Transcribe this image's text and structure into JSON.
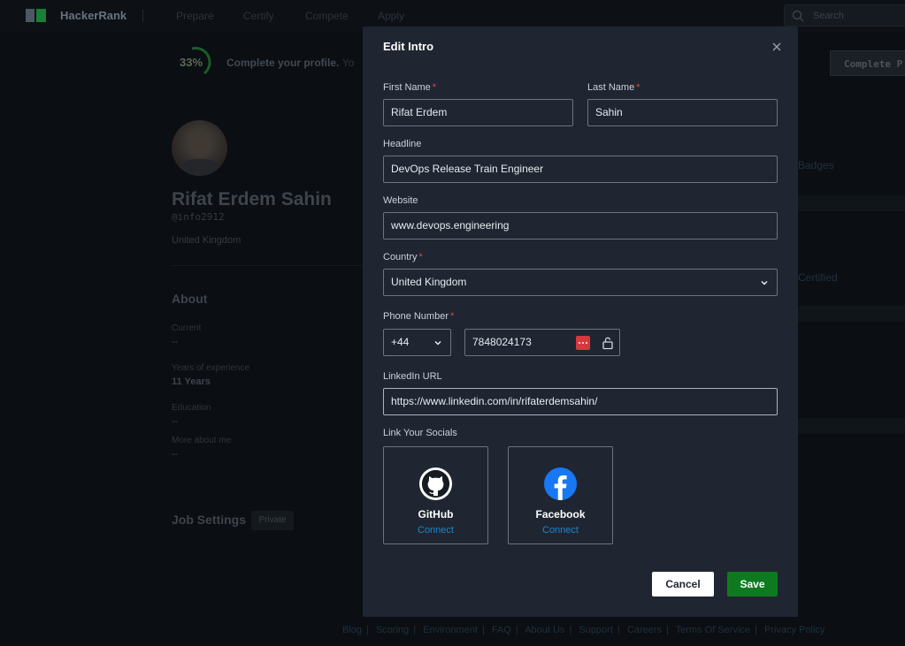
{
  "nav": {
    "brand": "HackerRank",
    "links": [
      "Prepare",
      "Certify",
      "Compete",
      "Apply"
    ],
    "search_placeholder": "Search"
  },
  "profile": {
    "progress_percent": "33%",
    "progress_value": 0.33,
    "complete_text": "Complete your profile.",
    "complete_text_tail": "Yo",
    "complete_button": "Complete P",
    "name": "Rifat Erdem Sahin",
    "handle": "@info2912",
    "location": "United Kingdom",
    "about_heading": "About",
    "current_label": "Current",
    "current_value": "--",
    "experience_label": "Years of experience",
    "experience_value": "11 Years",
    "education_label": "Education",
    "education_value": "--",
    "more_label": "More about me",
    "more_value": "--",
    "job_settings": "Job Settings",
    "private_badge": "Private",
    "right_badges": "Badges",
    "right_certified": "Certified"
  },
  "footer": {
    "links": [
      "Blog",
      "Scoring",
      "Environment",
      "FAQ",
      "About Us",
      "Support",
      "Careers",
      "Terms Of Service",
      "Privacy Policy"
    ]
  },
  "modal": {
    "title": "Edit Intro",
    "first_name_label": "First Name",
    "first_name_value": "Rifat Erdem",
    "last_name_label": "Last Name",
    "last_name_value": "Sahin",
    "headline_label": "Headline",
    "headline_value": "DevOps Release Train Engineer",
    "website_label": "Website",
    "website_value": "www.devops.engineering",
    "country_label": "Country",
    "country_value": "United Kingdom",
    "phone_label": "Phone Number",
    "phone_code": "+44",
    "phone_value": "7848024173",
    "linkedin_label": "LinkedIn URL",
    "linkedin_value": "https://www.linkedin.com/in/rifaterdemsahin/",
    "socials_label": "Link Your Socials",
    "required_mark": "*",
    "socials": [
      {
        "name": "GitHub",
        "action": "Connect",
        "icon": "github-icon"
      },
      {
        "name": "Facebook",
        "action": "Connect",
        "icon": "facebook-icon"
      }
    ],
    "cancel_label": "Cancel",
    "save_label": "Save"
  },
  "colors": {
    "modal_bg": "#1f2632",
    "save_green": "#0e7a20",
    "link_blue": "#1d86c9",
    "required_red": "#e0463a",
    "facebook_blue": "#1877f2"
  }
}
